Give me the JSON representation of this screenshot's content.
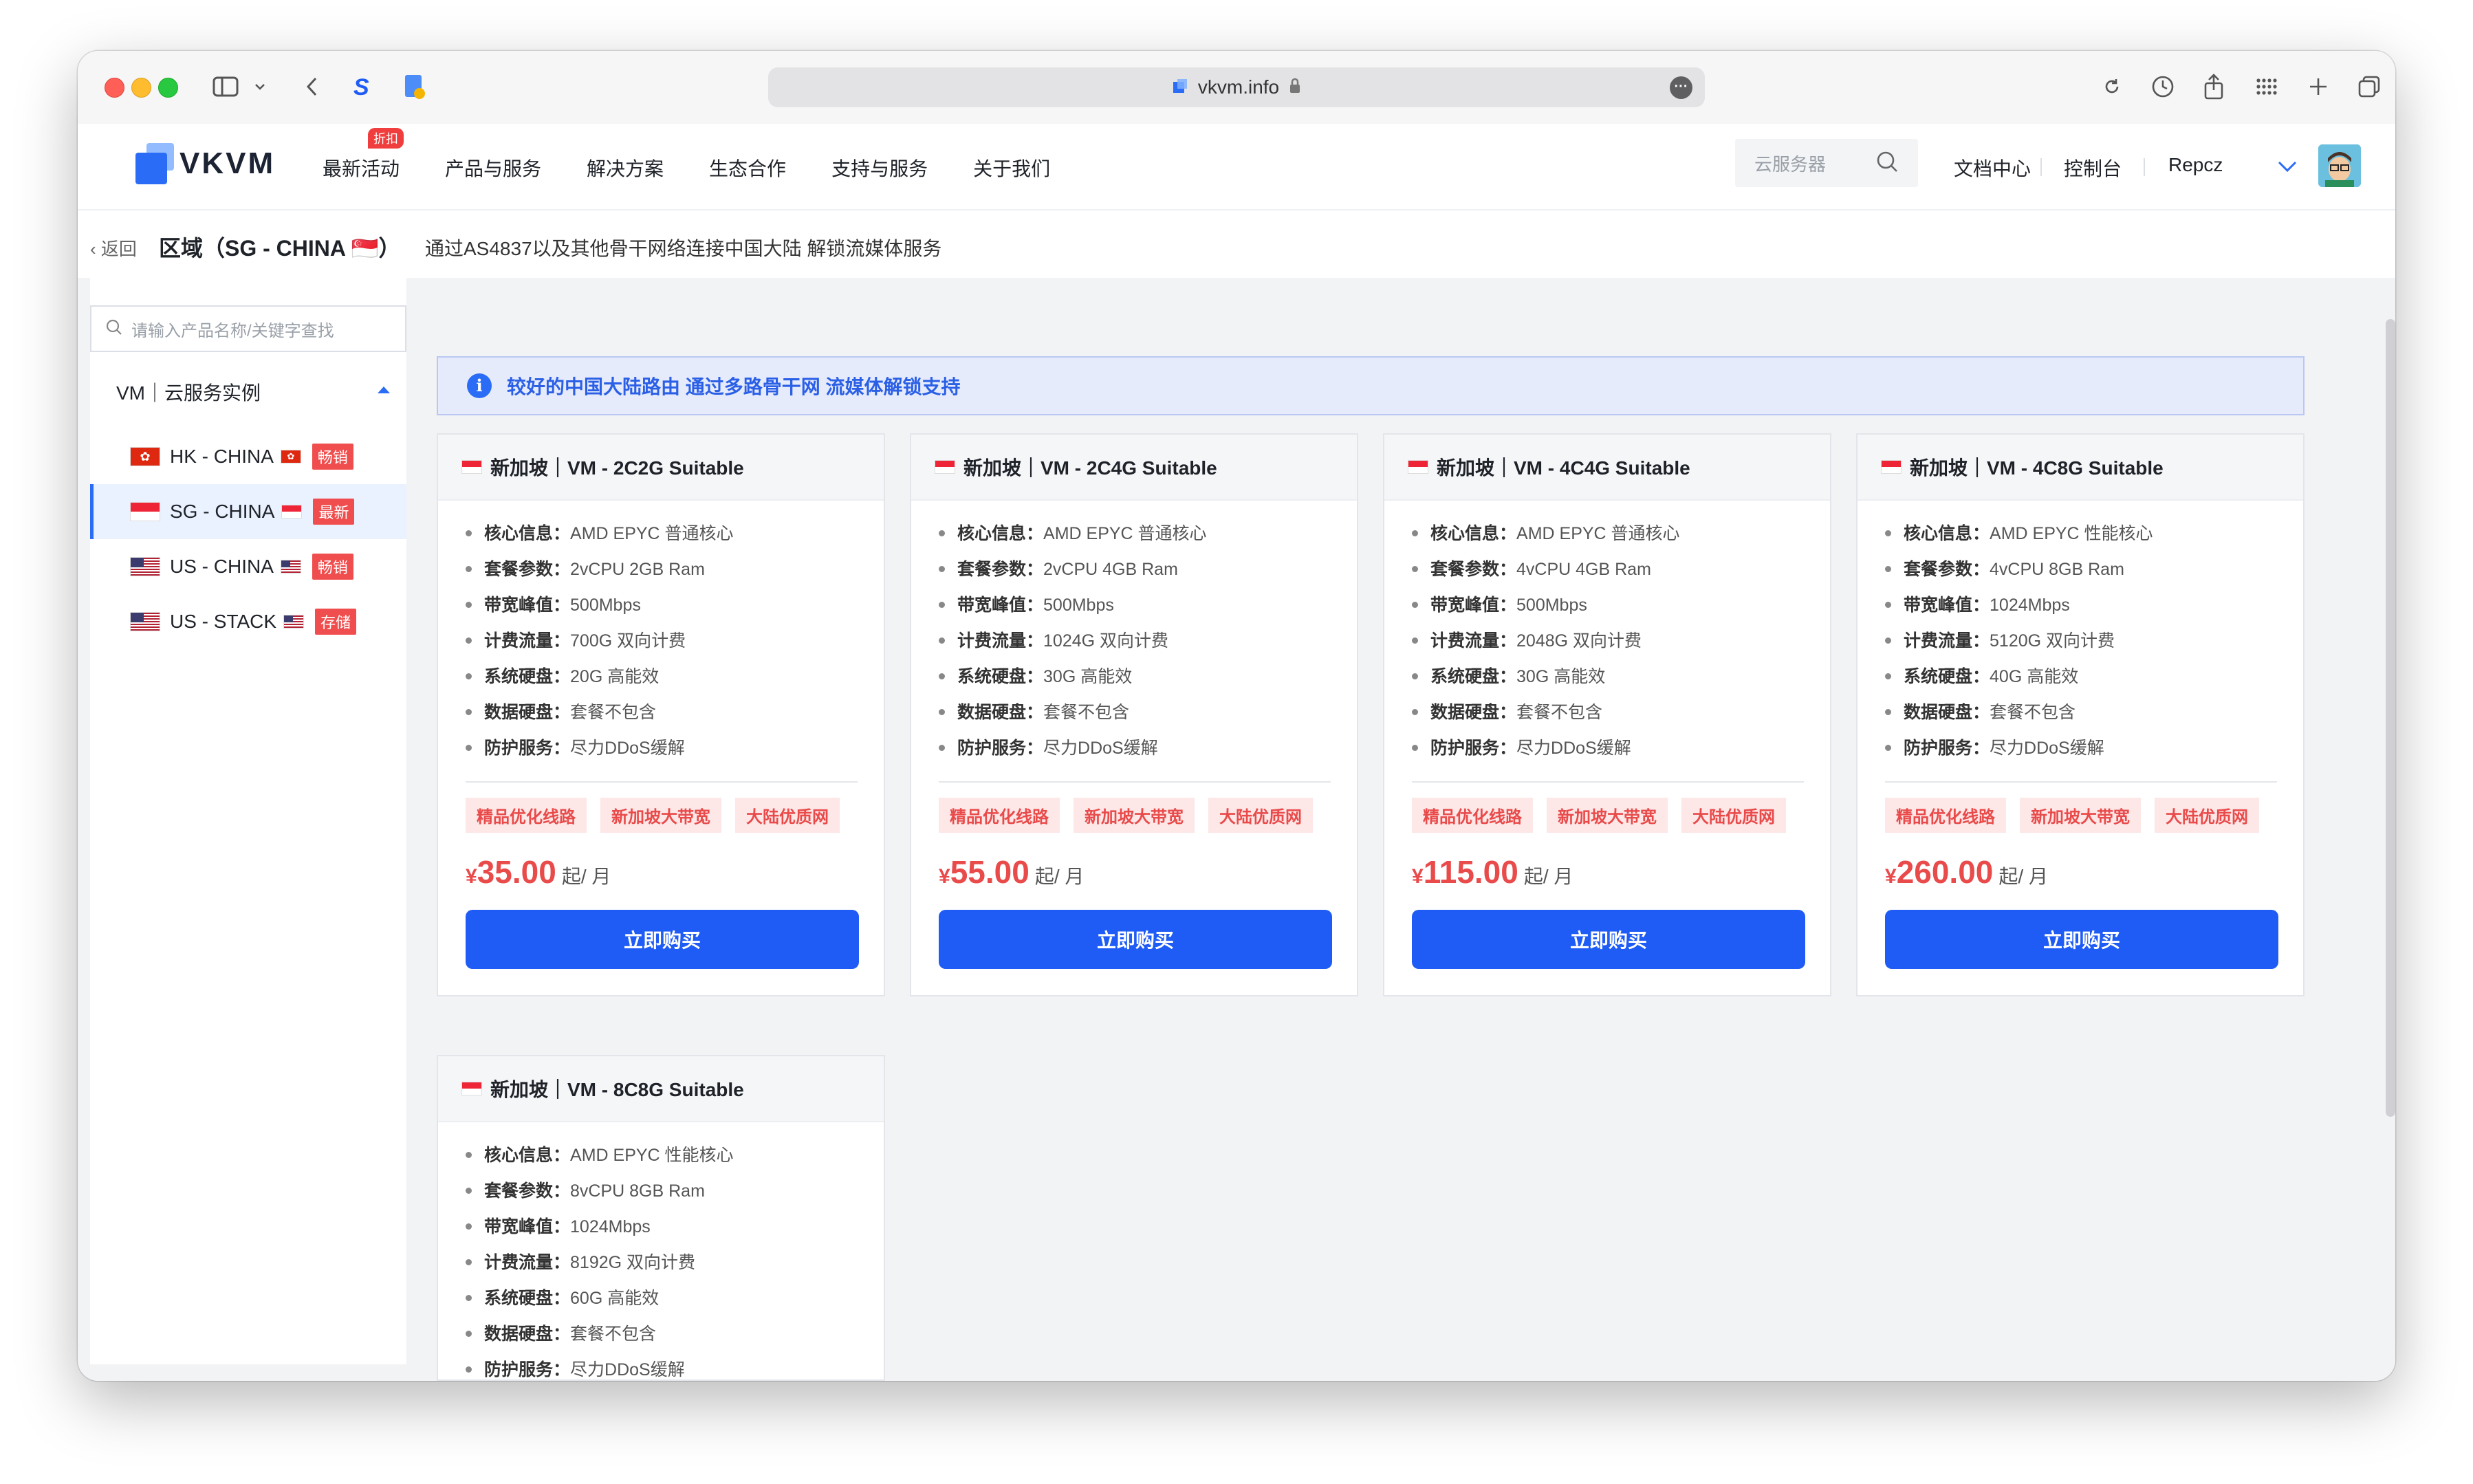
{
  "browser": {
    "url": "vkvm.info",
    "more_glyph": "···"
  },
  "site": {
    "logo_text": "VKVM",
    "nav": [
      {
        "label": "最新活动",
        "badge": "折扣"
      },
      {
        "label": "产品与服务"
      },
      {
        "label": "解决方案"
      },
      {
        "label": "生态合作"
      },
      {
        "label": "支持与服务"
      },
      {
        "label": "关于我们"
      }
    ],
    "search_placeholder": "云服务器",
    "docs": "文档中心",
    "console": "控制台",
    "user": "Repcz"
  },
  "breadcrumb": {
    "back": "返回",
    "region_title": "区域（SG - CHINA 🇸🇬）",
    "region_desc": "通过AS4837以及其他骨干网络连接中国大陆 解锁流媒体服务"
  },
  "sidebar": {
    "search_placeholder": "请输入产品名称/关键字查找",
    "group_label": "VM｜云服务实例",
    "items": [
      {
        "label": "HK - CHINA",
        "flag": "hk",
        "tag": "畅销",
        "active": false
      },
      {
        "label": "SG - CHINA",
        "flag": "sg",
        "tag": "最新",
        "active": true
      },
      {
        "label": "US - CHINA",
        "flag": "us",
        "tag": "畅销",
        "active": false
      },
      {
        "label": "US - STACK",
        "flag": "us",
        "tag": "存储",
        "active": false
      }
    ]
  },
  "notice": "较好的中国大陆路由 通过多路骨干网 流媒体解锁支持",
  "spec_keys": [
    "核心信息：",
    "套餐参数：",
    "带宽峰值：",
    "计费流量：",
    "系统硬盘：",
    "数据硬盘：",
    "防护服务："
  ],
  "products": [
    {
      "title": "新加坡｜VM - 2C2G Suitable",
      "specs": [
        "AMD EPYC 普通核心",
        "2vCPU 2GB Ram",
        "500Mbps",
        "700G 双向计费",
        "20G 高能效",
        "套餐不包含",
        "尽力DDoS缓解"
      ],
      "tags": [
        "精品优化线路",
        "新加坡大带宽",
        "大陆优质网"
      ],
      "currency": "¥",
      "price": "35.00",
      "unit": "起/ 月",
      "buy": "立即购买"
    },
    {
      "title": "新加坡｜VM - 2C4G Suitable",
      "specs": [
        "AMD EPYC 普通核心",
        "2vCPU 4GB Ram",
        "500Mbps",
        "1024G 双向计费",
        "30G 高能效",
        "套餐不包含",
        "尽力DDoS缓解"
      ],
      "tags": [
        "精品优化线路",
        "新加坡大带宽",
        "大陆优质网"
      ],
      "currency": "¥",
      "price": "55.00",
      "unit": "起/ 月",
      "buy": "立即购买"
    },
    {
      "title": "新加坡｜VM - 4C4G Suitable",
      "specs": [
        "AMD EPYC 普通核心",
        "4vCPU 4GB Ram",
        "500Mbps",
        "2048G 双向计费",
        "30G 高能效",
        "套餐不包含",
        "尽力DDoS缓解"
      ],
      "tags": [
        "精品优化线路",
        "新加坡大带宽",
        "大陆优质网"
      ],
      "currency": "¥",
      "price": "115.00",
      "unit": "起/ 月",
      "buy": "立即购买"
    },
    {
      "title": "新加坡｜VM - 4C8G Suitable",
      "specs": [
        "AMD EPYC 性能核心",
        "4vCPU 8GB Ram",
        "1024Mbps",
        "5120G 双向计费",
        "40G 高能效",
        "套餐不包含",
        "尽力DDoS缓解"
      ],
      "tags": [
        "精品优化线路",
        "新加坡大带宽",
        "大陆优质网"
      ],
      "currency": "¥",
      "price": "260.00",
      "unit": "起/ 月",
      "buy": "立即购买"
    },
    {
      "title": "新加坡｜VM - 8C8G Suitable",
      "specs": [
        "AMD EPYC 性能核心",
        "8vCPU 8GB Ram",
        "1024Mbps",
        "8192G 双向计费",
        "60G 高能效",
        "套餐不包含",
        "尽力DDoS缓解"
      ],
      "tags": [],
      "currency": "",
      "price": "",
      "unit": "",
      "buy": ""
    }
  ],
  "colors": {
    "primary": "#1f5cf5",
    "price_red": "#e94a4a",
    "tag_bg": "#fde7e7",
    "notice_bg": "#e6ebfb"
  }
}
